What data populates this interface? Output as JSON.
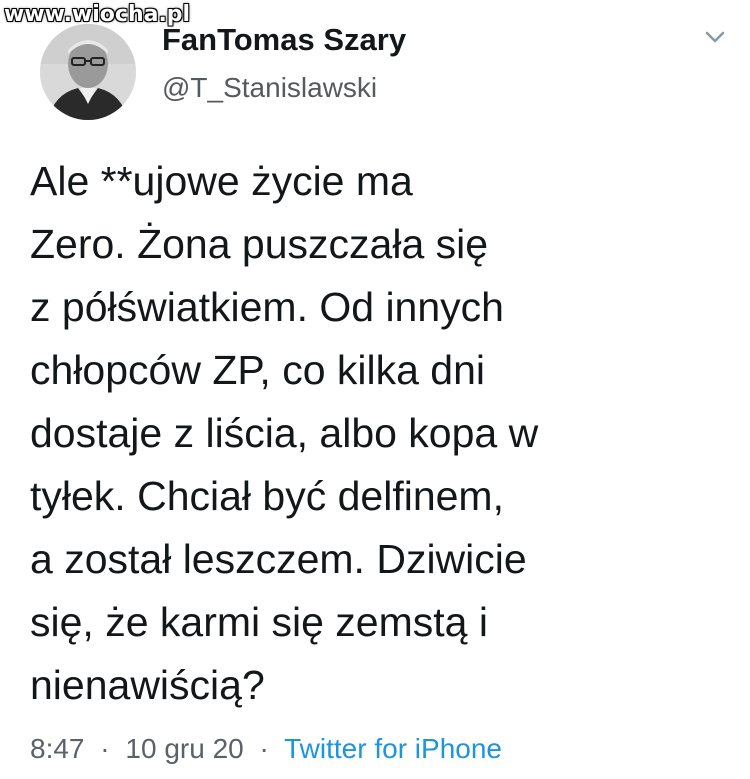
{
  "watermark": "www.wiocha.pl",
  "author": {
    "display_name": "FanTomas Szary",
    "handle": "@T_Stanislawski"
  },
  "tweet": {
    "lines": [
      "Ale **ujowe życie ma",
      "Zero. Żona puszczała się",
      "z półświatkiem. Od innych",
      "chłopców ZP, co kilka dni",
      "dostaje z liścia, albo kopa w",
      "tyłek. Chciał być delfinem,",
      "a został leszczem. Dziwicie",
      "się, że karmi się zemstą i",
      "nienawiścią?"
    ]
  },
  "meta": {
    "time": "8:47",
    "separator": "·",
    "date": "10 gru 20",
    "source": "Twitter for iPhone"
  },
  "icons": {
    "menu": "chevron-down-icon"
  },
  "colors": {
    "link": "#1b95e0",
    "secondary_text": "#5b6168"
  }
}
